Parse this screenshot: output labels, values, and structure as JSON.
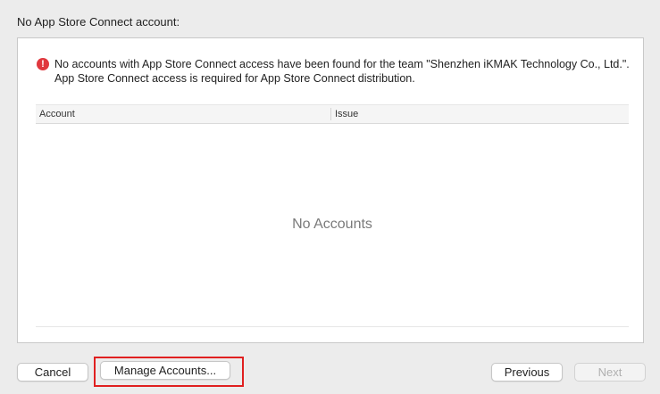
{
  "heading": "No App Store Connect account:",
  "alert": {
    "icon": "exclamation-circle-icon",
    "icon_glyph": "!",
    "message": "No accounts with App Store Connect access have been found for the team \"Shenzhen iKMAK Technology Co., Ltd.\". App Store Connect access is required for App Store Connect distribution."
  },
  "table": {
    "columns": [
      "Account",
      "Issue"
    ],
    "rows": [],
    "empty_message": "No Accounts"
  },
  "buttons": {
    "cancel": "Cancel",
    "manage_accounts": "Manage Accounts...",
    "previous": "Previous",
    "next": "Next"
  },
  "colors": {
    "background": "#ececec",
    "alert_icon": "#e0383e",
    "highlight_outline": "#e02020"
  }
}
